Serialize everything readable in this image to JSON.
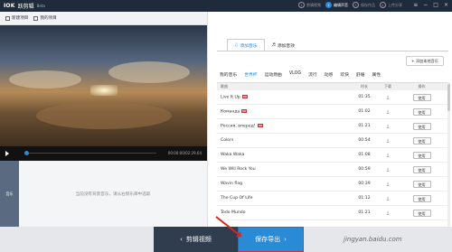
{
  "app": {
    "logo": "IOK",
    "name": "跃剪辑",
    "beta": "Beta"
  },
  "steps": [
    {
      "num": "1",
      "label": "剪辑视频"
    },
    {
      "num": "2",
      "label": "编辑声音"
    },
    {
      "num": "3",
      "label": "保存作品"
    },
    {
      "num": "4",
      "label": "上传分享"
    }
  ],
  "toolbar": {
    "new_project": "新建项目",
    "my_projects": "我的项目"
  },
  "player": {
    "time": "00:00:00/02:29.64"
  },
  "tracks": {
    "music_label": "音乐",
    "empty_hint": "当前没有背景音乐，请从右侧乐库中选取"
  },
  "sidebar": {
    "tab_music": "添加音乐",
    "tab_sfx": "添加音效",
    "add_local": "+ 添加本地音乐",
    "categories": [
      "我的音乐",
      "世界杯",
      "运动燃曲",
      "VLOG",
      "流行",
      "动感",
      "欢快",
      "舒缓",
      "属性"
    ],
    "active_category": 1,
    "columns": {
      "title": "歌曲",
      "duration": "时长",
      "download": "下载",
      "action": "操作"
    },
    "use_label": "使用",
    "songs": [
      {
        "title": "Live It Up",
        "duration": "01:35",
        "flag": true
      },
      {
        "title": "Команда",
        "duration": "01:02",
        "flag": true
      },
      {
        "title": "Россия, вперед!",
        "duration": "01:21",
        "flag": true
      },
      {
        "title": "Colors",
        "duration": "00:54",
        "flag": false
      },
      {
        "title": "Waka Waka",
        "duration": "01:08",
        "flag": false
      },
      {
        "title": "We Will Rock You",
        "duration": "00:59",
        "flag": false
      },
      {
        "title": "Wavin flag",
        "duration": "00:39",
        "flag": false
      },
      {
        "title": "The Cup Of Life",
        "duration": "01:12",
        "flag": false
      },
      {
        "title": "Todo Mundo",
        "duration": "01:21",
        "flag": false
      }
    ]
  },
  "footer": {
    "back_label": "剪辑视频",
    "save_label": "保存导出",
    "watermark": "jingyan.baidu.com"
  },
  "colors": {
    "accent": "#2b8ad6",
    "titlebar": "#1f2a3a",
    "highlight": "#e22222"
  }
}
